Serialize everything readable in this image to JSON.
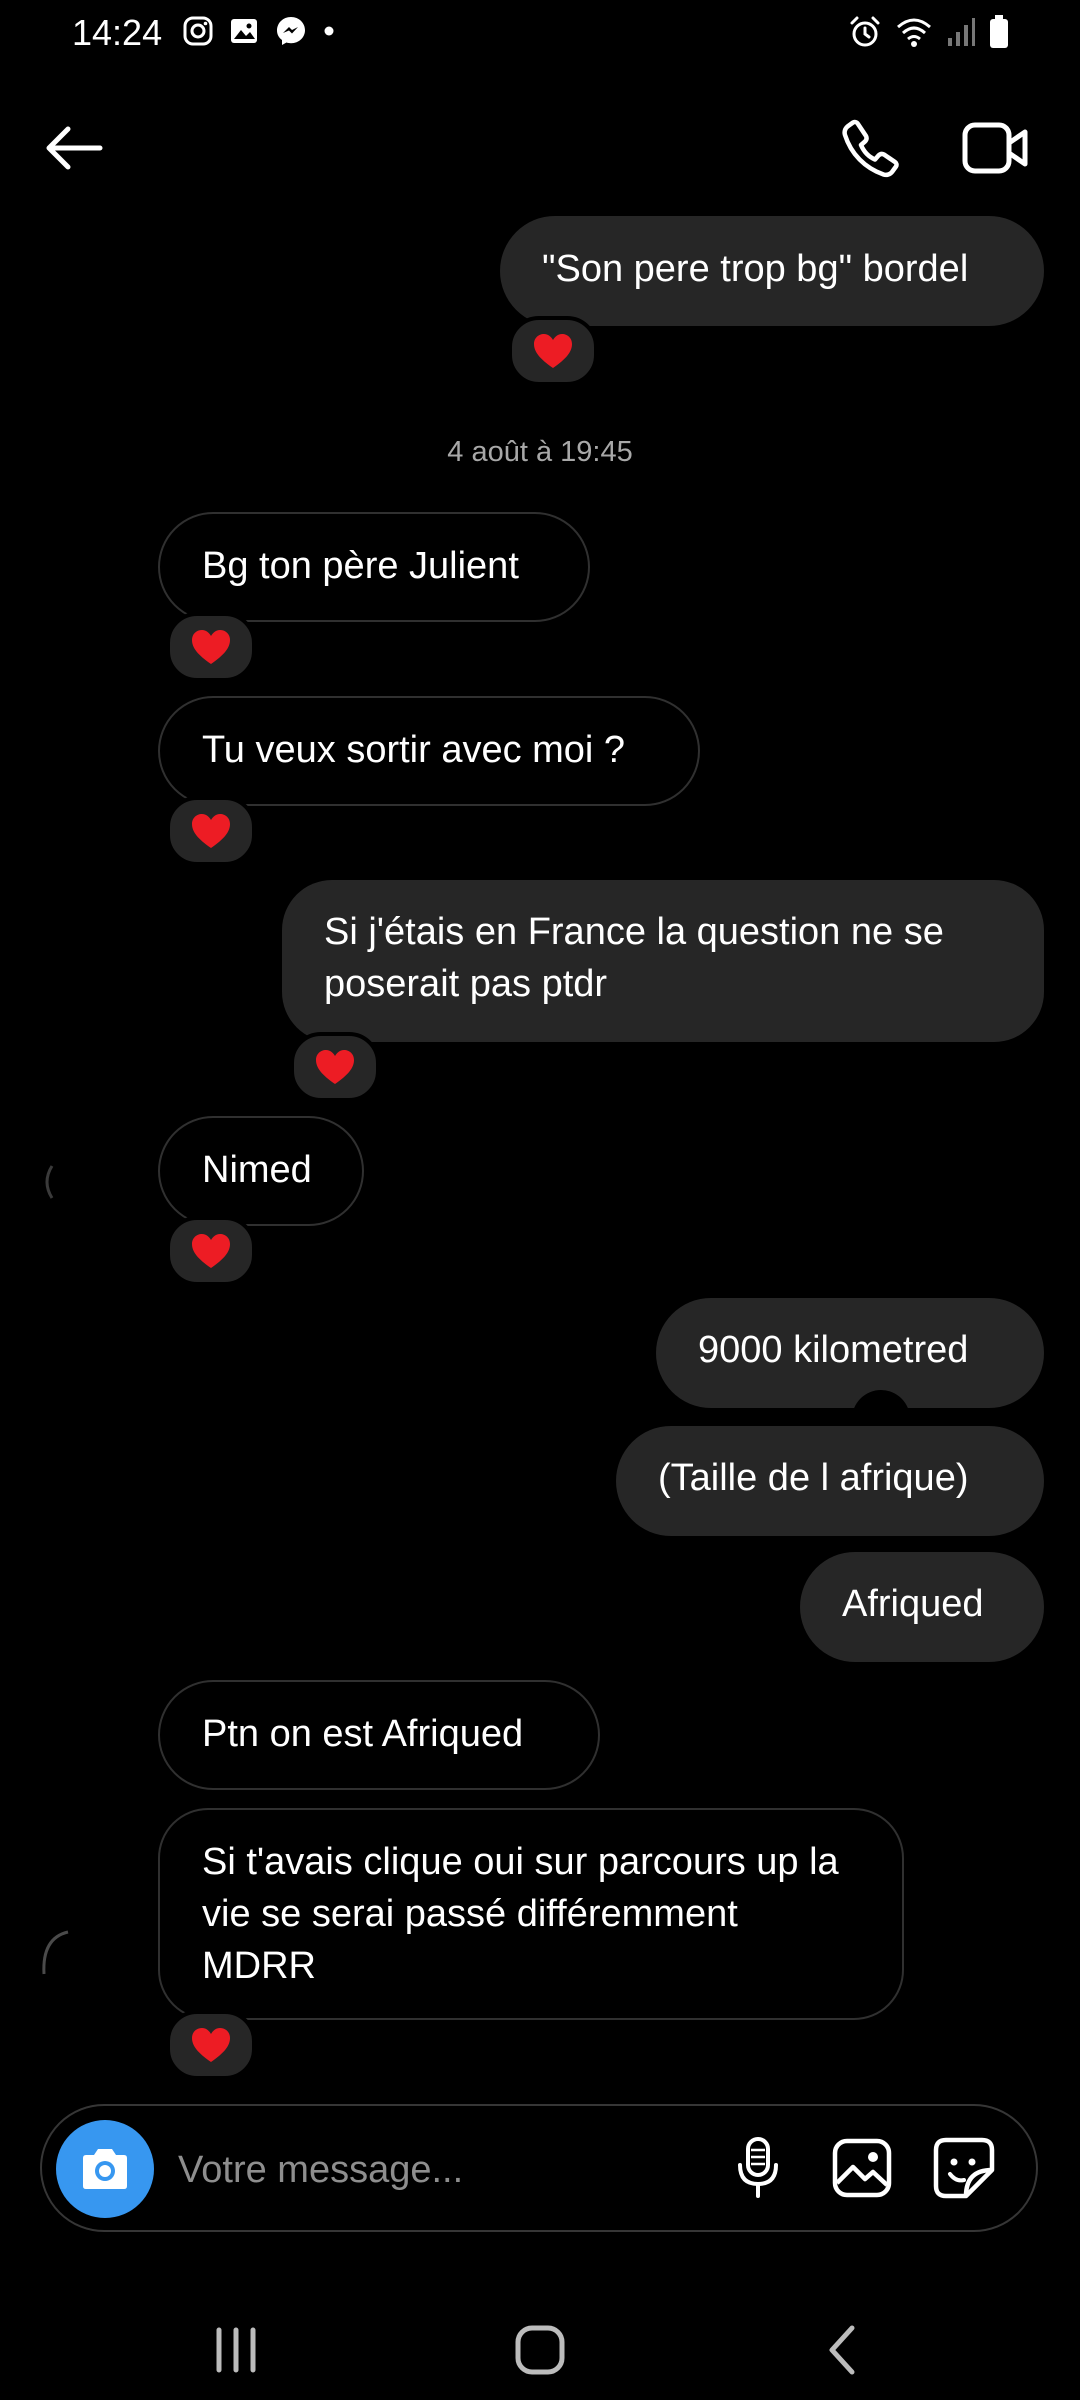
{
  "status_bar": {
    "time": "14:24",
    "left_icons": [
      "instagram-icon",
      "gallery-icon",
      "messenger-icon",
      "dot-icon"
    ],
    "right_icons": [
      "alarm-icon",
      "wifi-icon",
      "signal-icon",
      "battery-icon"
    ]
  },
  "header": {
    "back_icon": "arrow-left-icon",
    "call_icon": "phone-icon",
    "video_icon": "video-camera-icon"
  },
  "messages": [
    {
      "id": "m1",
      "direction": "sent",
      "text": "\"Son pere trop bg\" bordel",
      "reaction": "❤️"
    },
    {
      "id": "m2",
      "direction": "received",
      "text": "Bg ton père Julient",
      "reaction": "❤️"
    },
    {
      "id": "m3",
      "direction": "received",
      "text": "Tu veux sortir avec moi ?",
      "reaction": "❤️"
    },
    {
      "id": "m4",
      "direction": "sent",
      "text": "Si j'étais en France la question ne se poserait pas ptdr",
      "reaction": "❤️"
    },
    {
      "id": "m5",
      "direction": "received",
      "text": "Nimed",
      "reaction": "❤️"
    },
    {
      "id": "m6",
      "direction": "sent",
      "text": "9000 kilometred"
    },
    {
      "id": "m7",
      "direction": "sent",
      "text": "(Taille de l afrique)"
    },
    {
      "id": "m8",
      "direction": "sent",
      "text": "Afriqued"
    },
    {
      "id": "m9",
      "direction": "received",
      "text": "Ptn on est Afriqued"
    },
    {
      "id": "m10",
      "direction": "received",
      "text": "Si t'avais clique oui sur parcours up la vie se serai passé différemment MDRR",
      "reaction": "❤️"
    }
  ],
  "timestamp": "4 août à 19:45",
  "composer": {
    "placeholder": "Votre message...",
    "camera_icon": "camera-icon",
    "mic_icon": "microphone-icon",
    "gallery_icon": "image-icon",
    "sticker_icon": "sticker-icon"
  },
  "nav_bar": {
    "recents_icon": "recents-icon",
    "home_icon": "home-icon",
    "back_icon": "nav-back-icon"
  },
  "colors": {
    "background": "#000000",
    "sent_bubble": "#262626",
    "received_border": "#303030",
    "accent": "#3797f0",
    "heart": "#ed1c24",
    "muted_text": "#a8a8a8"
  }
}
